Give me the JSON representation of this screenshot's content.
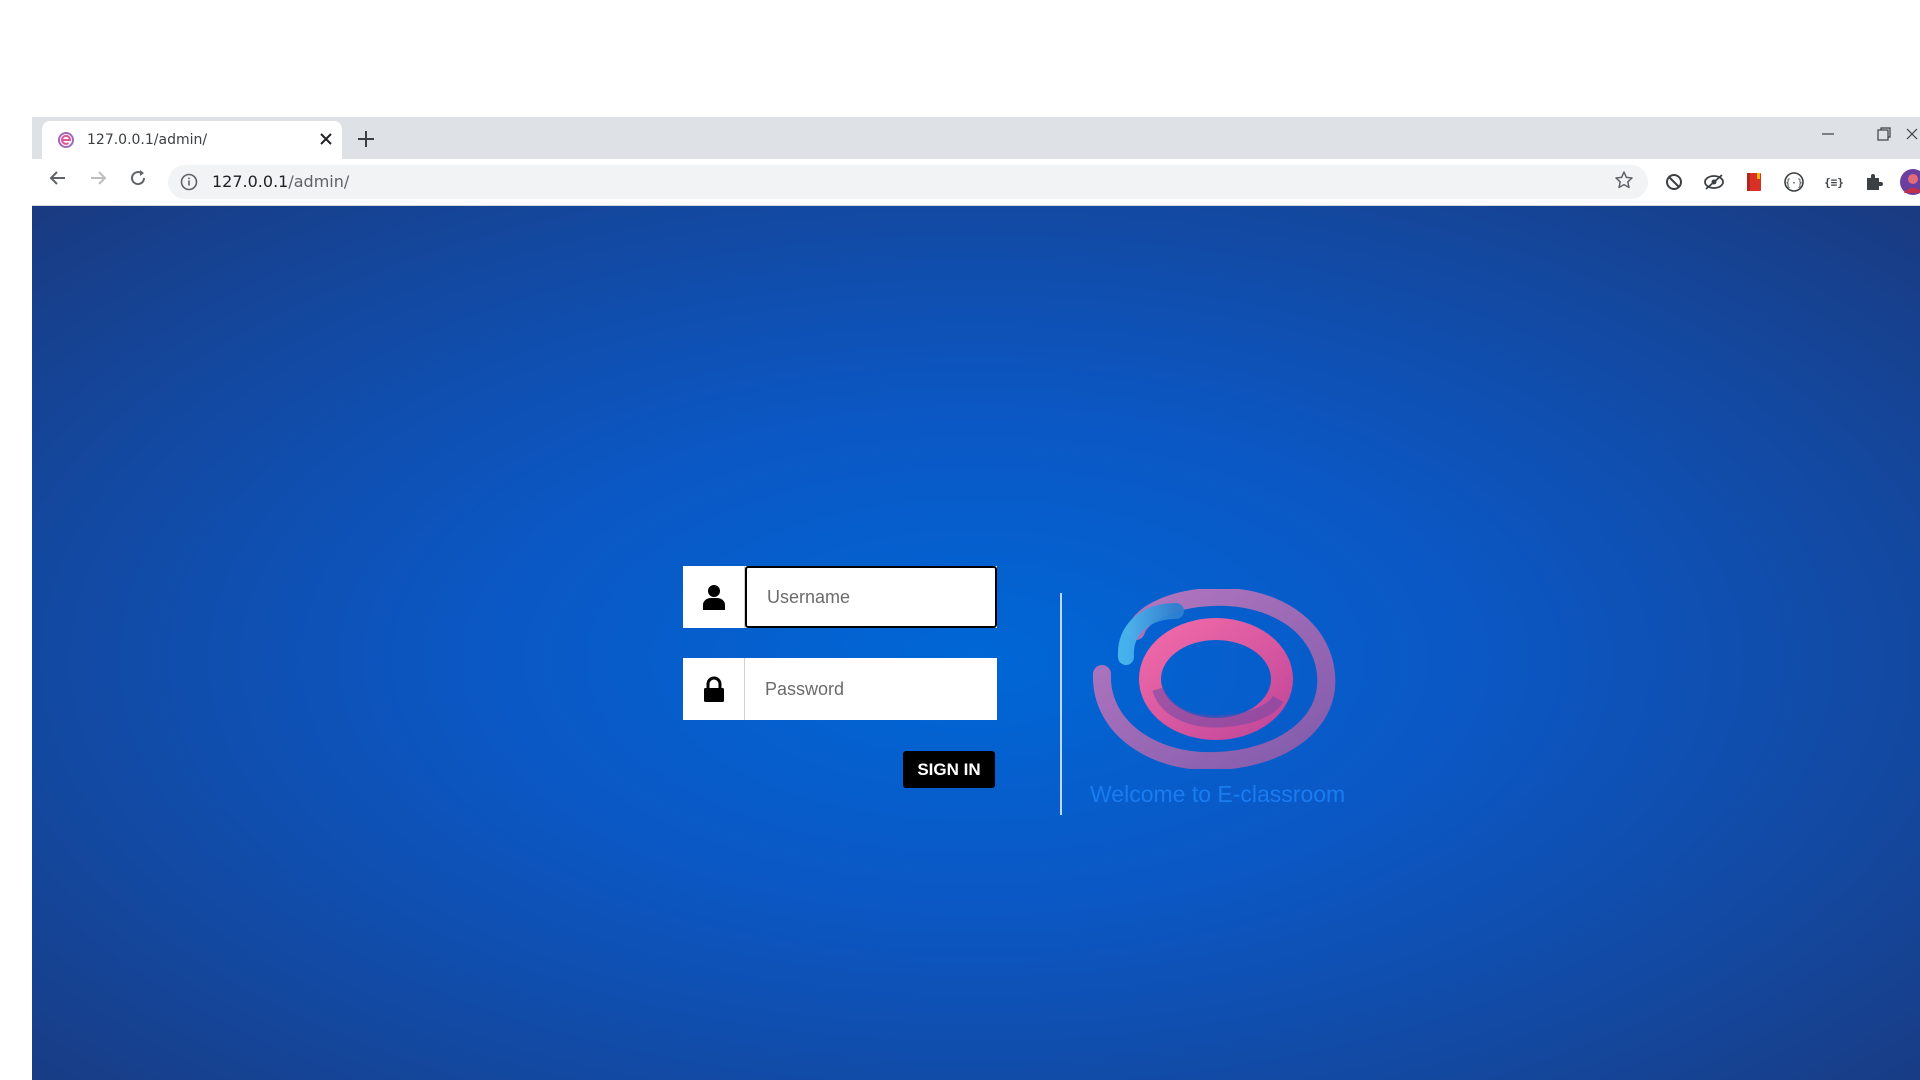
{
  "browser": {
    "tab": {
      "title": "127.0.0.1/admin/",
      "favicon_icon": "e-classroom-logo-icon",
      "close_icon": "close-icon"
    },
    "new_tab_icon": "plus-icon",
    "window_controls": [
      "minimize-icon",
      "restore-icon",
      "close-icon"
    ],
    "toolbar": {
      "back_icon": "arrow-left-icon",
      "forward_icon": "arrow-right-icon",
      "reload_icon": "reload-icon",
      "info_icon": "info-icon",
      "url_host": "127.0.0.1",
      "url_path": "/admin/",
      "bookmark_icon": "star-icon",
      "extensions": [
        "block-icon",
        "eye-slash-icon",
        "red-book-icon",
        "braces-circle-icon",
        "braces-icon",
        "puzzle-icon",
        "profile-avatar"
      ]
    }
  },
  "login": {
    "username_placeholder": "Username",
    "password_placeholder": "Password",
    "username_icon": "user-icon",
    "password_icon": "lock-icon",
    "signin_label": "SIGN IN"
  },
  "brand": {
    "logo_icon": "e-classroom-logo-icon",
    "welcome_text": "Welcome to E-classroom"
  },
  "colors": {
    "page_bg": "#0b57c4",
    "welcome_text": "#1a7cf0",
    "button_bg": "#000000",
    "logo_pink": "#e0569d",
    "logo_purple": "#8e5aa8",
    "logo_blue": "#3aa0e0"
  }
}
